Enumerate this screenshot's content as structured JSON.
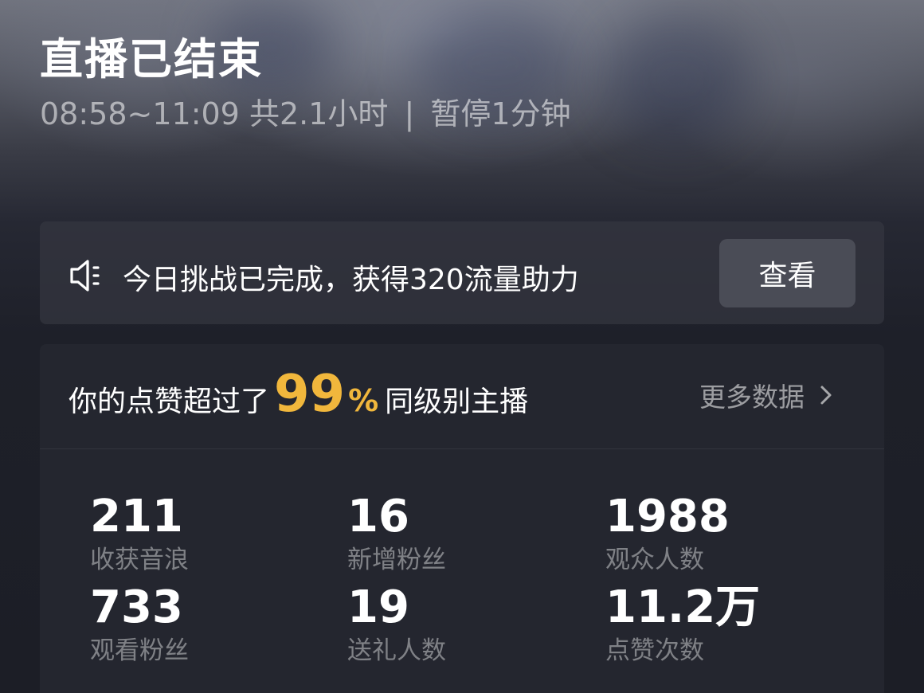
{
  "header": {
    "title": "直播已结束",
    "time_range": "08:58~11:09",
    "duration": "共2.1小时",
    "separator": "|",
    "pause": "暂停1分钟"
  },
  "challenge": {
    "text": "今日挑战已完成，获得320流量助力",
    "button_label": "查看",
    "icon": "speaker-icon"
  },
  "likes_rank": {
    "prefix": "你的点赞超过了",
    "percent": "99",
    "percent_sign": "%",
    "suffix": "同级别主播",
    "more_label": "更多数据",
    "accent_color": "#f1b73c"
  },
  "stats": [
    {
      "value": "211",
      "label": "收获音浪"
    },
    {
      "value": "16",
      "label": "新增粉丝"
    },
    {
      "value": "1988",
      "label": "观众人数"
    },
    {
      "value": "733",
      "label": "观看粉丝"
    },
    {
      "value": "19",
      "label": "送礼人数"
    },
    {
      "value": "11.2万",
      "label": "点赞次数"
    }
  ]
}
